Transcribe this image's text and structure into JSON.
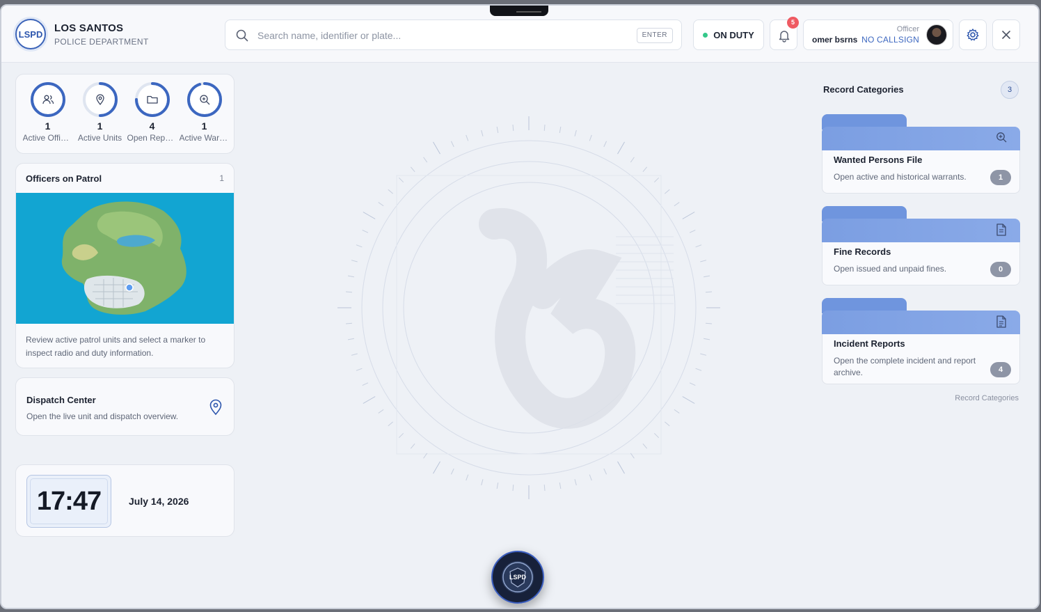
{
  "header": {
    "logo_text": "LSPD",
    "title": "LOS SANTOS",
    "subtitle": "POLICE DEPARTMENT",
    "search_placeholder": "Search name, identifier or plate...",
    "search_key": "ENTER",
    "duty_status": "ON DUTY",
    "notifications_count": "5",
    "user_role": "Officer",
    "user_name": "omer bsrns",
    "user_callsign": "NO CALLSIGN"
  },
  "stats": [
    {
      "value": "1",
      "label": "Active Officers",
      "progress": 1.0,
      "icon": "users-icon"
    },
    {
      "value": "1",
      "label": "Active Units",
      "progress": 0.5,
      "icon": "map-pin-icon"
    },
    {
      "value": "4",
      "label": "Open Reports",
      "progress": 0.75,
      "icon": "folder-icon"
    },
    {
      "value": "1",
      "label": "Active Warrants",
      "progress": 0.95,
      "icon": "zoom-icon"
    }
  ],
  "patrol": {
    "title": "Officers on Patrol",
    "count": "1",
    "description": "Review active patrol units and select a marker to inspect radio and duty information."
  },
  "dispatch": {
    "title": "Dispatch Center",
    "description": "Open the live unit and dispatch overview."
  },
  "clock": {
    "time": "17:47",
    "date": "July 14, 2026"
  },
  "record_categories": {
    "title": "Record Categories",
    "count": "3",
    "footer": "Record Categories",
    "items": [
      {
        "name": "Wanted Persons File",
        "description": "Open active and historical warrants.",
        "count": "1",
        "icon": "zoom-icon"
      },
      {
        "name": "Fine Records",
        "description": "Open issued and unpaid fines.",
        "count": "0",
        "icon": "document-icon"
      },
      {
        "name": "Incident Reports",
        "description": "Open the complete incident and report archive.",
        "count": "4",
        "icon": "report-icon"
      }
    ]
  },
  "colors": {
    "accent": "#3c67c0",
    "folder": "#7b9ee2",
    "duty_dot": "#34c88a",
    "notification": "#ef5a62"
  }
}
